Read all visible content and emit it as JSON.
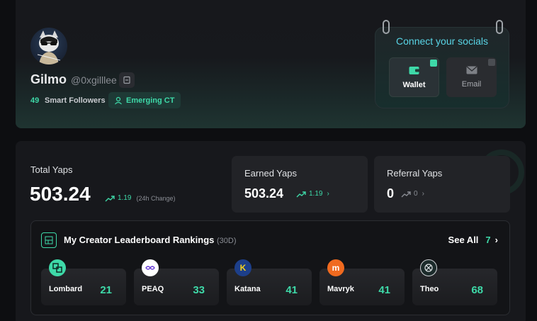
{
  "profile": {
    "username": "Gilmo",
    "handle": "@0xgilllee",
    "followers_count": "49",
    "followers_label": "Smart Followers",
    "badge": "Emerging CT"
  },
  "socials": {
    "title": "Connect your socials",
    "wallet_label": "Wallet",
    "email_label": "Email"
  },
  "stats": {
    "total_label": "Total Yaps",
    "total_value": "503.24",
    "total_change": "1.19",
    "total_change_note": "(24h Change)",
    "earned_label": "Earned Yaps",
    "earned_value": "503.24",
    "earned_change": "1.19",
    "referral_label": "Referral Yaps",
    "referral_value": "0",
    "referral_change": "0"
  },
  "leaderboard": {
    "title": "My Creator Leaderboard Rankings",
    "period": "(30D)",
    "see_all": "See All",
    "see_all_count": "7",
    "items": [
      {
        "name": "Lombard",
        "rank": "21",
        "logo_color": "#3ed9a8"
      },
      {
        "name": "PEAQ",
        "rank": "33",
        "logo_color": "#ffffff"
      },
      {
        "name": "Katana",
        "rank": "41",
        "logo_color": "#f5d31c"
      },
      {
        "name": "Mavryk",
        "rank": "41",
        "logo_color": "#f06a1f"
      },
      {
        "name": "Theo",
        "rank": "68",
        "logo_color": "#1c2b2b"
      }
    ]
  },
  "colors": {
    "accent": "#3ed9a8",
    "socials_title": "#59d5e6",
    "background": "#0d0e11"
  }
}
